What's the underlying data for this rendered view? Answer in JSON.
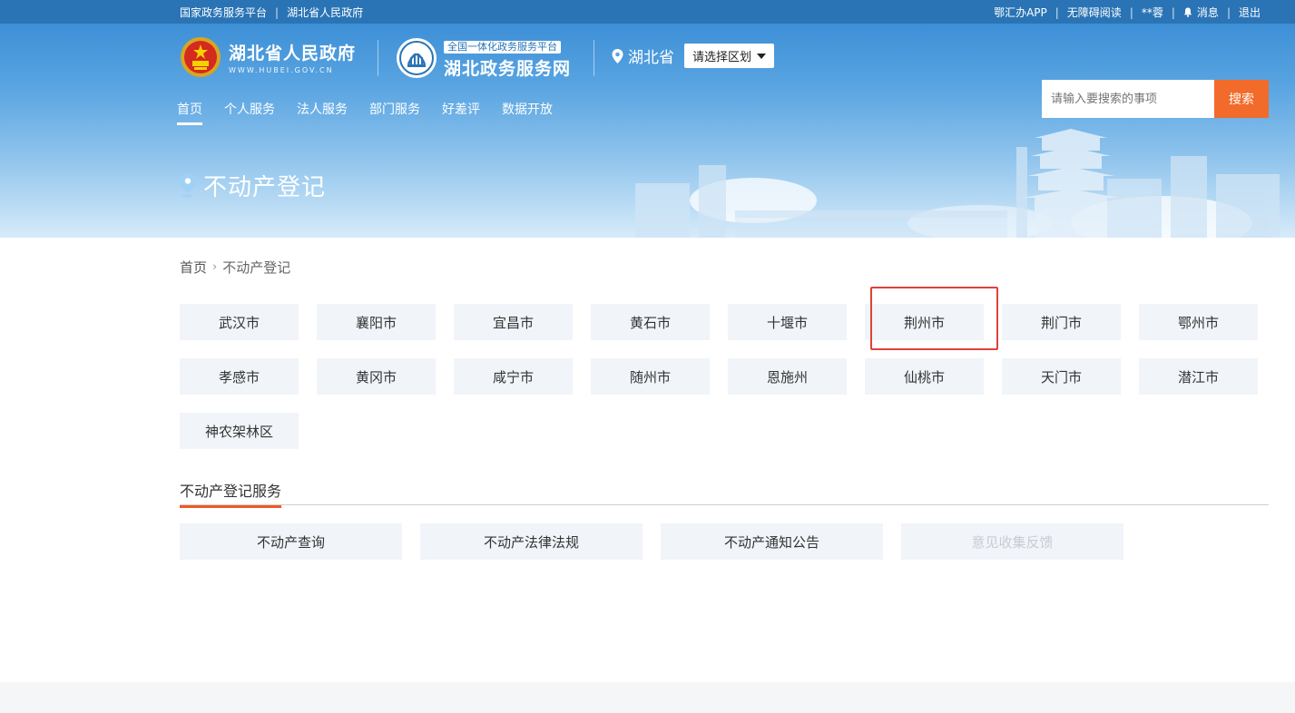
{
  "topbar": {
    "left_links": [
      "国家政务服务平台",
      "湖北省人民政府"
    ],
    "right_links": {
      "app": "鄂汇办APP",
      "accessibility": "无障碍阅读",
      "user": "**蓉",
      "messages": "消息",
      "logout": "退出"
    }
  },
  "header": {
    "logo1_title": "湖北省人民政府",
    "logo1_sub": "WWW.HUBEI.GOV.CN",
    "logo2_tag": "全国一体化政务服务平台",
    "logo2_title": "湖北政务服务网",
    "region_name": "湖北省",
    "region_select": "请选择区划",
    "nav": [
      "首页",
      "个人服务",
      "法人服务",
      "部门服务",
      "好差评",
      "数据开放"
    ],
    "active_nav": "首页",
    "search_placeholder": "请输入要搜索的事项",
    "search_button": "搜索",
    "page_title": "不动产登记"
  },
  "breadcrumb": {
    "home": "首页",
    "current": "不动产登记"
  },
  "cities": [
    "武汉市",
    "襄阳市",
    "宜昌市",
    "黄石市",
    "十堰市",
    "荆州市",
    "荆门市",
    "鄂州市",
    "孝感市",
    "黄冈市",
    "咸宁市",
    "随州市",
    "恩施州",
    "仙桃市",
    "天门市",
    "潜江市",
    "神农架林区"
  ],
  "highlighted_city": "荆州市",
  "services": {
    "heading": "不动产登记服务",
    "items": [
      "不动产查询",
      "不动产法律法规",
      "不动产通知公告",
      "意见收集反馈"
    ],
    "disabled_item": "意见收集反馈"
  },
  "colors": {
    "topbar": "#2a74b5",
    "accent_orange": "#f26b2a",
    "highlight_red": "#e0423a",
    "tile_bg": "#f1f4f9"
  }
}
